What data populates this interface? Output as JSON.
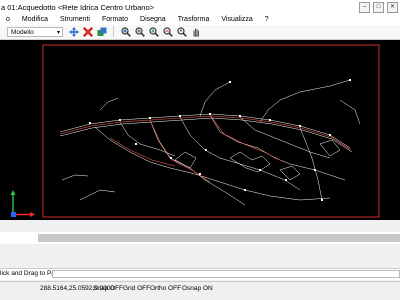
{
  "window": {
    "title": "a 01:Acquedotto <Rete Idrica Centro Urbano>",
    "min_glyph": "–",
    "max_glyph": "□",
    "close_glyph": "✕"
  },
  "menu": [
    "o",
    "Modifica",
    "Strumenti",
    "Formato",
    "Disegna",
    "Trasforma",
    "Visualizza",
    "?"
  ],
  "toolbar": {
    "layout_value": "Modello",
    "icons": [
      "move-icon",
      "delete-icon",
      "add-icon",
      "zoom-window-icon",
      "zoom-extents-icon",
      "zoom-in-icon",
      "zoom-out-icon",
      "zoom-realtime-icon",
      "pan-icon"
    ]
  },
  "command": {
    "prompt": "lick and Drag to Pan:"
  },
  "status": {
    "coords": "288.5164,25.0592,0.0000",
    "snap": "Snap OFF",
    "grid": "Grid OFF",
    "ortho": "Ortho OFF",
    "osnap": "Osnap ON"
  },
  "colors": {
    "canvas": "#000000",
    "frame": "#ff3b3b",
    "drawing": "#ffffff"
  }
}
